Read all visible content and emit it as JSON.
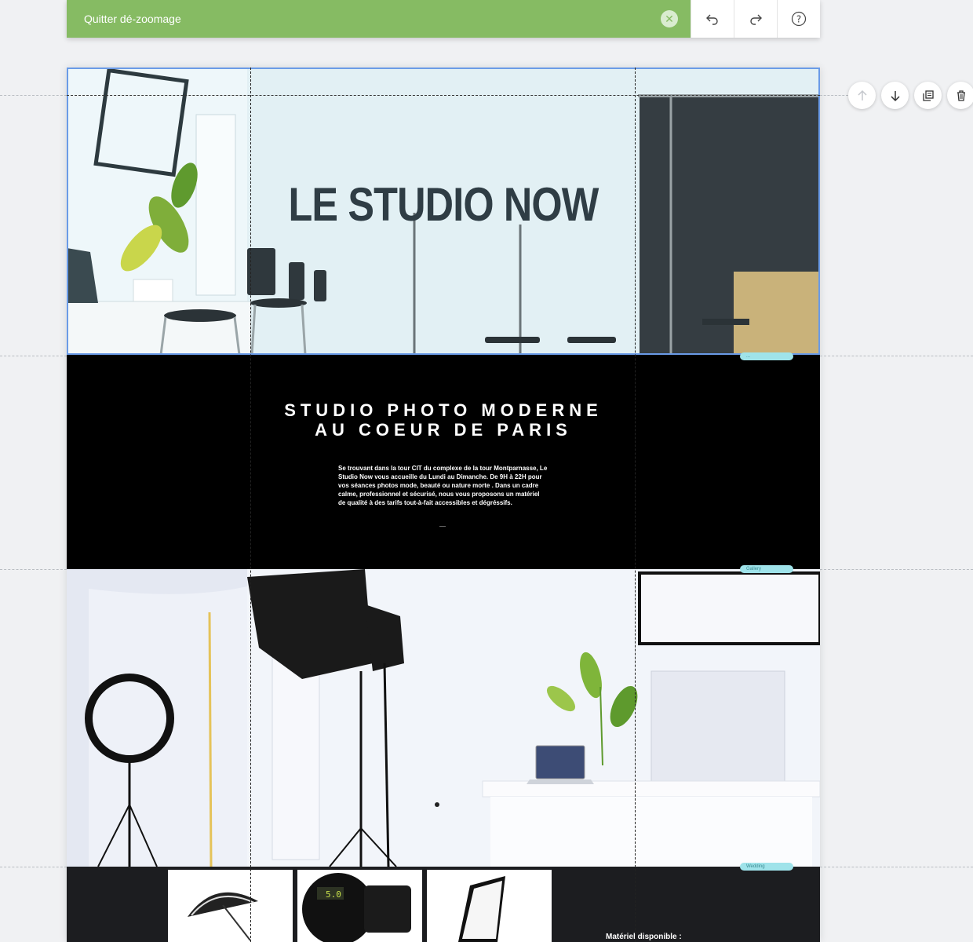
{
  "toolbar": {
    "exit_label": "Quitter dé-zoomage",
    "exit_icon": "close-icon",
    "undo_icon": "undo-icon",
    "redo_icon": "redo-icon",
    "help_icon": "help-icon",
    "accent": "#86bb63"
  },
  "hero": {
    "title": "LE STUDIO NOW",
    "selection_color": "#6a9be7"
  },
  "intro": {
    "title_line1": "STUDIO PHOTO MODERNE",
    "title_line2": "AU COEUR DE PARIS",
    "body": "Se trouvant dans la tour CIT du complexe de la tour Montparnasse, Le Studio Now vous accueille du Lundi au Dimanche. De 9H à 22H pour vos séances photos mode, beauté ou nature morte .  Dans un cadre calme, professionnel et sécurisé, nous vous proposons un matériel de qualité à des tarifs tout-à-fait accessibles et dégréssifs."
  },
  "section_tags": {
    "tag1": "...",
    "tag2": "Gallery",
    "tag3": "Wedding"
  },
  "gear": {
    "label": "Matériel disponible :",
    "flash_display": "5.0"
  },
  "side_actions": {
    "move_up_icon": "arrow-up-icon",
    "move_down_icon": "arrow-down-icon",
    "duplicate_icon": "duplicate-icon",
    "delete_icon": "trash-icon"
  }
}
